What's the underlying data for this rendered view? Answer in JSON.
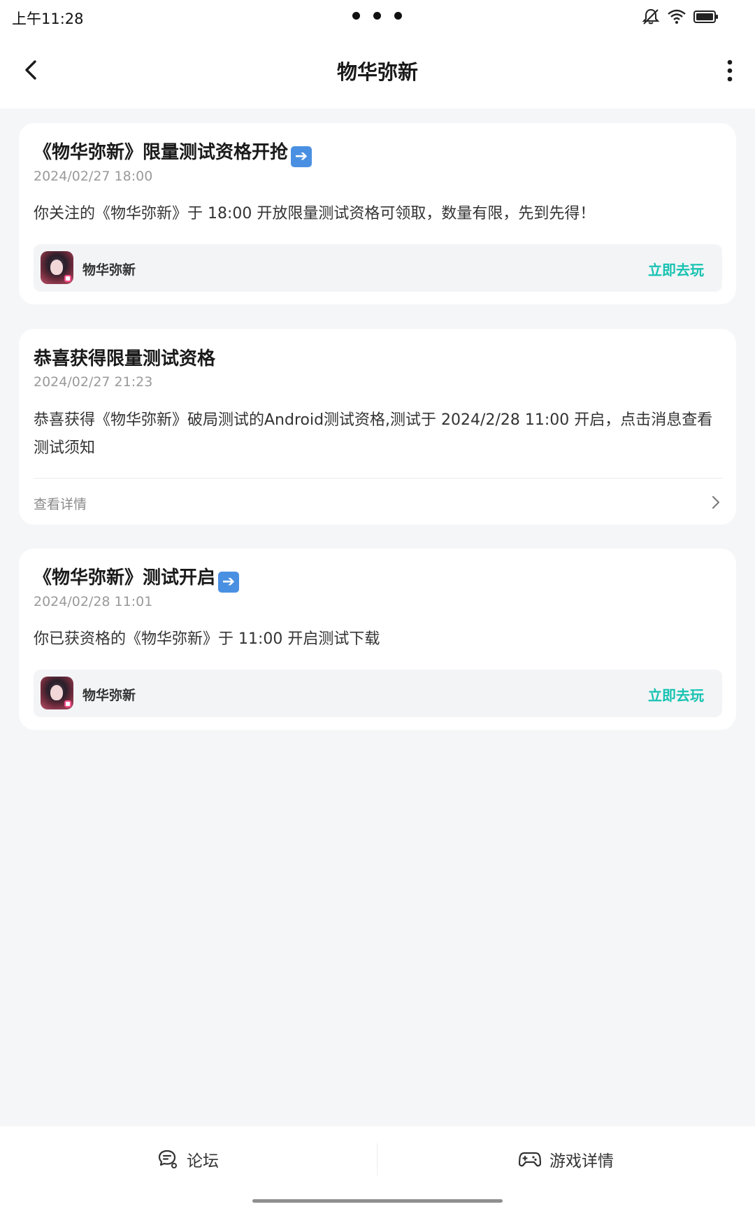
{
  "status_bar": {
    "time": "上午11:28"
  },
  "header": {
    "title": "物华弥新"
  },
  "cards": [
    {
      "title": "《物华弥新》限量测试资格开抢",
      "time": "2024/02/27 18:00",
      "body": "你关注的《物华弥新》于 18:00 开放限量测试资格可领取，数量有限，先到先得！",
      "game": {
        "name": "物华弥新",
        "action": "立即去玩"
      }
    },
    {
      "title": "恭喜获得限量测试资格",
      "time": "2024/02/27 21:23",
      "body": "恭喜获得《物华弥新》破局测试的Android测试资格,测试于 2024/2/28 11:00 开启，点击消息查看测试须知",
      "detail": "查看详情"
    },
    {
      "title": "《物华弥新》测试开启",
      "time": "2024/02/28 11:01",
      "body": "你已获资格的《物华弥新》于 11:00 开启测试下载",
      "game": {
        "name": "物华弥新",
        "action": "立即去玩"
      }
    }
  ],
  "bottom_bar": {
    "forum": "论坛",
    "game_details": "游戏详情"
  },
  "colors": {
    "accent": "#17C3B2",
    "background": "#F5F6F8"
  }
}
